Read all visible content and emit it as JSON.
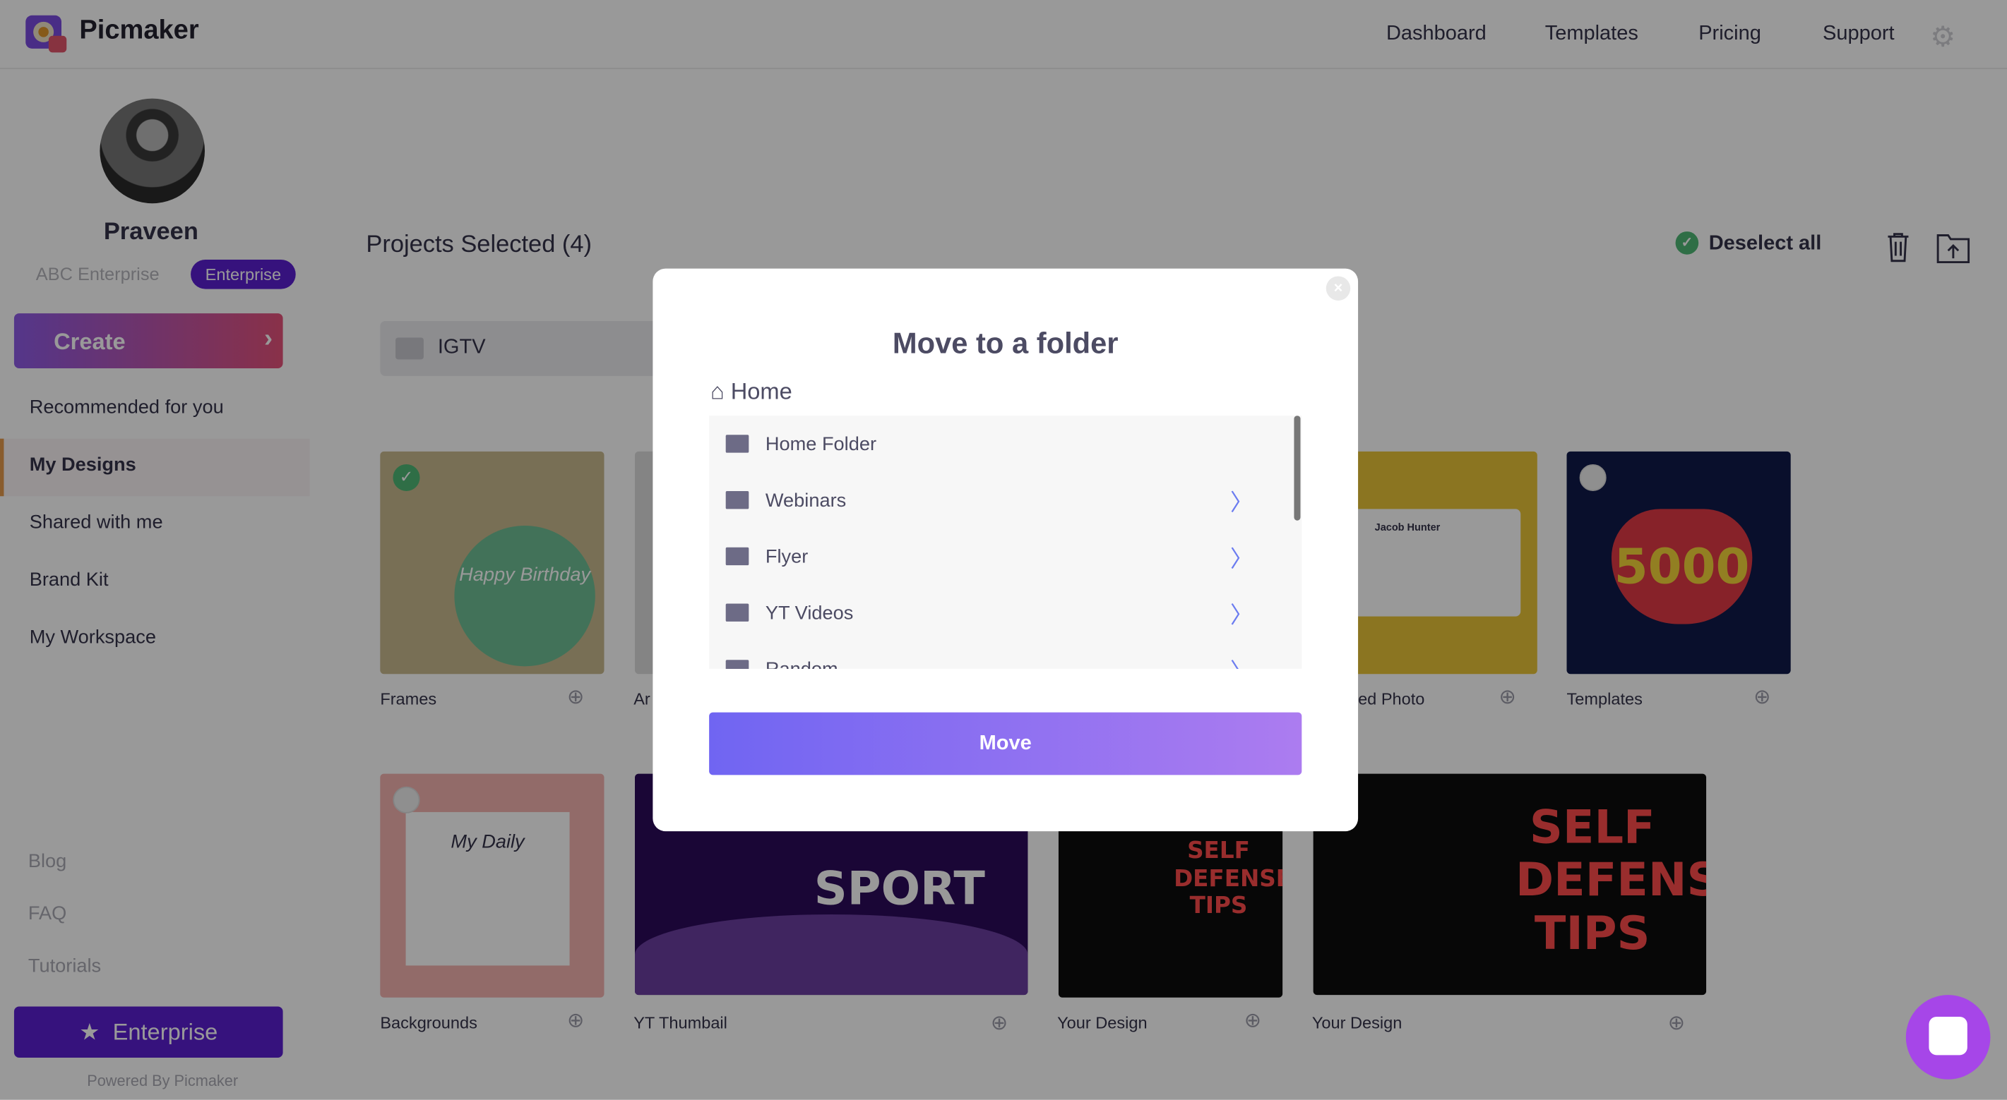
{
  "app": {
    "name": "Picmaker"
  },
  "header": {
    "nav": [
      "Dashboard",
      "Templates",
      "Pricing",
      "Support"
    ],
    "settings_icon": "gear-icon"
  },
  "user": {
    "name": "Praveen",
    "org": "ABC Enterprise",
    "plan_badge": "Enterprise"
  },
  "sidebar": {
    "create_label": "Create",
    "items": [
      {
        "label": "Recommended for you"
      },
      {
        "label": "My Designs",
        "active": true
      },
      {
        "label": "Shared with me"
      },
      {
        "label": "Brand Kit"
      },
      {
        "label": "My Workspace"
      }
    ],
    "footer_links": [
      "Blog",
      "FAQ",
      "Tutorials"
    ],
    "enterprise_label": "Enterprise",
    "powered_by": "Powered By Picmaker"
  },
  "main": {
    "selection_title": "Projects Selected (4)",
    "deselect_label": "Deselect all",
    "folder": "IGTV",
    "cards": [
      {
        "label": "Frames",
        "selected": true,
        "art": "Happy Birthday"
      },
      {
        "label": "Ar",
        "selected": true
      },
      {
        "label": "ed Photo",
        "art": "Jacob Hunter"
      },
      {
        "label": "Templates",
        "selected": false,
        "art": "5000"
      },
      {
        "label": "Backgrounds",
        "selected": false,
        "art": "My Daily"
      },
      {
        "label": "YT Thumbail",
        "art": "SPORT"
      },
      {
        "label": "Your Design",
        "art": "SELF DEFENSE TIPS"
      },
      {
        "label": "Your Design",
        "art": "SELF DEFENSE TIPS"
      }
    ]
  },
  "modal": {
    "title": "Move to a folder",
    "breadcrumb": "Home",
    "folders": [
      "Home Folder",
      "Webinars",
      "Flyer",
      "YT Videos",
      "Random"
    ],
    "has_children": [
      false,
      true,
      true,
      true,
      true
    ],
    "move_label": "Move",
    "close_label": "×"
  },
  "colors": {
    "brand_purple": "#5a1ed0",
    "move_gradient": [
      "#7065f2",
      "#ac7cf0"
    ],
    "selected_green": "#4fb876",
    "chat": "#a646e8"
  }
}
